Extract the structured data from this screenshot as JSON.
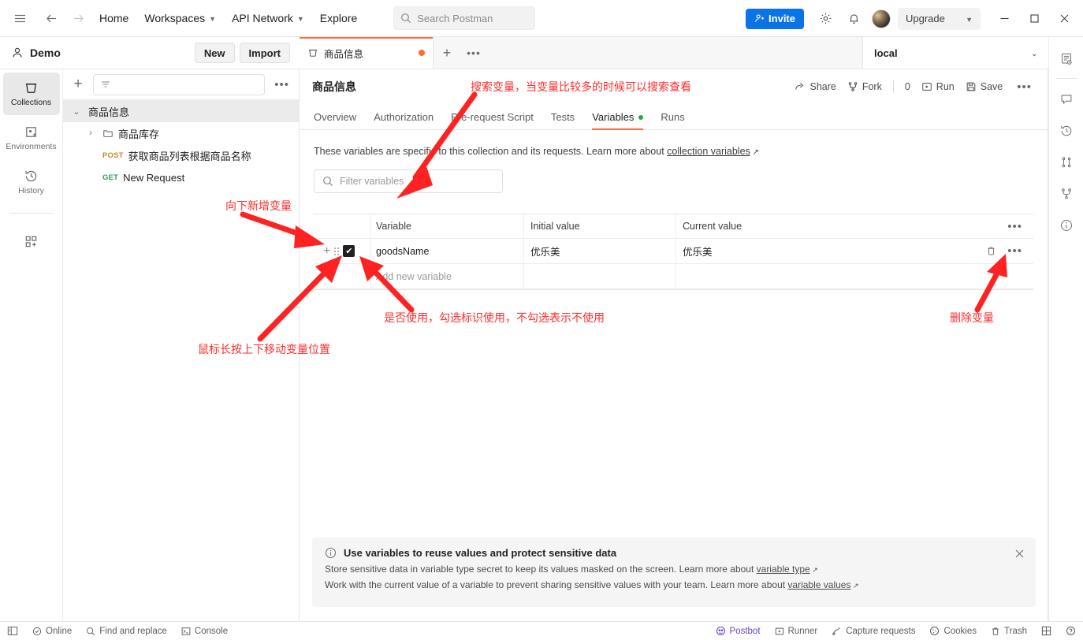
{
  "topbar": {
    "nav": [
      {
        "label": "Home",
        "caret": false
      },
      {
        "label": "Workspaces",
        "caret": true
      },
      {
        "label": "API Network",
        "caret": true
      },
      {
        "label": "Explore",
        "caret": false
      }
    ],
    "search_placeholder": "Search Postman",
    "invite_label": "Invite",
    "upgrade_label": "Upgrade"
  },
  "workspace": {
    "name": "Demo",
    "new_label": "New",
    "import_label": "Import"
  },
  "rail": {
    "items": [
      {
        "label": "Collections",
        "icon": "collection-icon",
        "active": true
      },
      {
        "label": "Environments",
        "icon": "environment-icon",
        "active": false
      },
      {
        "label": "History",
        "icon": "history-icon",
        "active": false
      }
    ],
    "add_label": ""
  },
  "sidebar": {
    "filter_placeholder": "",
    "tree": [
      {
        "label": "商品信息",
        "type": "collection",
        "expanded": true,
        "selected": true
      },
      {
        "label": "商品库存",
        "type": "folder",
        "expanded": false
      },
      {
        "label": "获取商品列表根据商品名称",
        "type": "request",
        "method": "POST"
      },
      {
        "label": "New Request",
        "type": "request",
        "method": "GET"
      }
    ]
  },
  "tabs": {
    "open": [
      {
        "label": "商品信息",
        "unsaved": true,
        "active": true
      }
    ],
    "environment_selected": "local"
  },
  "main": {
    "collection_title": "商品信息",
    "actions": [
      {
        "label": "Share",
        "icon": "share-icon"
      },
      {
        "label": "Fork",
        "icon": "fork-icon"
      },
      {
        "label": "0",
        "icon": "fork-count"
      },
      {
        "label": "Run",
        "icon": "run-icon"
      },
      {
        "label": "Save",
        "icon": "save-icon"
      }
    ],
    "tabs": [
      {
        "label": "Overview",
        "active": false,
        "dot": false
      },
      {
        "label": "Authorization",
        "active": false,
        "dot": false
      },
      {
        "label": "Pre-request Script",
        "active": false,
        "dot": false
      },
      {
        "label": "Tests",
        "active": false,
        "dot": false
      },
      {
        "label": "Variables",
        "active": true,
        "dot": true
      },
      {
        "label": "Runs",
        "active": false,
        "dot": false
      }
    ],
    "description_text": "These variables are specific to this collection and its requests. Learn more about ",
    "description_link": "collection variables",
    "filter_placeholder": "Filter variables",
    "table": {
      "columns": [
        "Variable",
        "Initial value",
        "Current value"
      ],
      "rows": [
        {
          "enabled": true,
          "variable": "goodsName",
          "initial_value": "优乐美",
          "current_value": "优乐美"
        }
      ],
      "new_row_placeholder": "Add new variable"
    }
  },
  "banner": {
    "title": "Use variables to reuse values and protect sensitive data",
    "line1_pre": "Store sensitive data in variable type secret to keep its values masked on the screen. Learn more about ",
    "line1_link": "variable type",
    "line2_pre": "Work with the current value of a variable to prevent sharing sensitive values with your team. Learn more about ",
    "line2_link": "variable values"
  },
  "status": {
    "left": [
      {
        "label": "Online",
        "icon": "online-icon"
      },
      {
        "label": "Find and replace",
        "icon": "search-icon"
      },
      {
        "label": "Console",
        "icon": "console-icon"
      }
    ],
    "right": [
      {
        "label": "Postbot",
        "icon": "postbot-icon"
      },
      {
        "label": "Runner",
        "icon": "runner-icon"
      },
      {
        "label": "Capture requests",
        "icon": "capture-icon"
      },
      {
        "label": "Cookies",
        "icon": "cookies-icon"
      },
      {
        "label": "Trash",
        "icon": "trash-icon"
      }
    ]
  },
  "annotations": [
    {
      "id": "search-var",
      "text": "搜索变量，当变量比较多的时候可以搜索查看"
    },
    {
      "id": "add-var",
      "text": "向下新增变量"
    },
    {
      "id": "move-var",
      "text": "鼠标长按上下移动变量位置"
    },
    {
      "id": "enable-var",
      "text": "是否使用，勾选标识使用，不勾选表示不使用"
    },
    {
      "id": "delete-var",
      "text": "删除变量"
    }
  ],
  "colors": {
    "accent": "#ff6c37",
    "invite_blue": "#0a74e6",
    "annotation_red": "#ff2d2d",
    "method_post": "#c08a2e",
    "method_get": "#3a9a52",
    "green_dot": "#2aa745",
    "postbot_purple": "#6b43c2"
  }
}
